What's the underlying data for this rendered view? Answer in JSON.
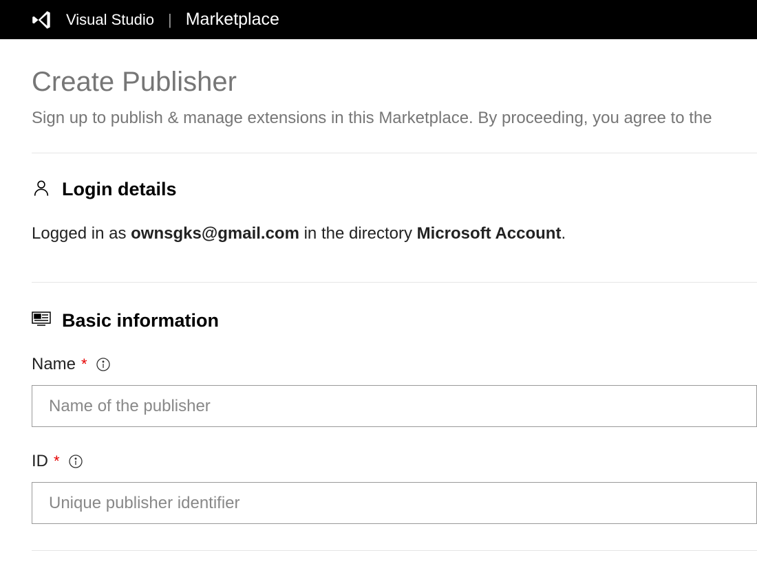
{
  "header": {
    "brand": "Visual Studio",
    "product": "Marketplace"
  },
  "page": {
    "title": "Create Publisher",
    "subtitle": "Sign up to publish & manage extensions in this Marketplace. By proceeding, you agree to the"
  },
  "login": {
    "section_title": "Login details",
    "prefix": "Logged in as ",
    "email": "ownsgks@gmail.com",
    "middle": " in the directory ",
    "directory": "Microsoft Account",
    "suffix": "."
  },
  "basic_info": {
    "section_title": "Basic information",
    "name": {
      "label": "Name",
      "placeholder": "Name of the publisher",
      "value": ""
    },
    "id": {
      "label": "ID",
      "placeholder": "Unique publisher identifier",
      "value": ""
    }
  }
}
